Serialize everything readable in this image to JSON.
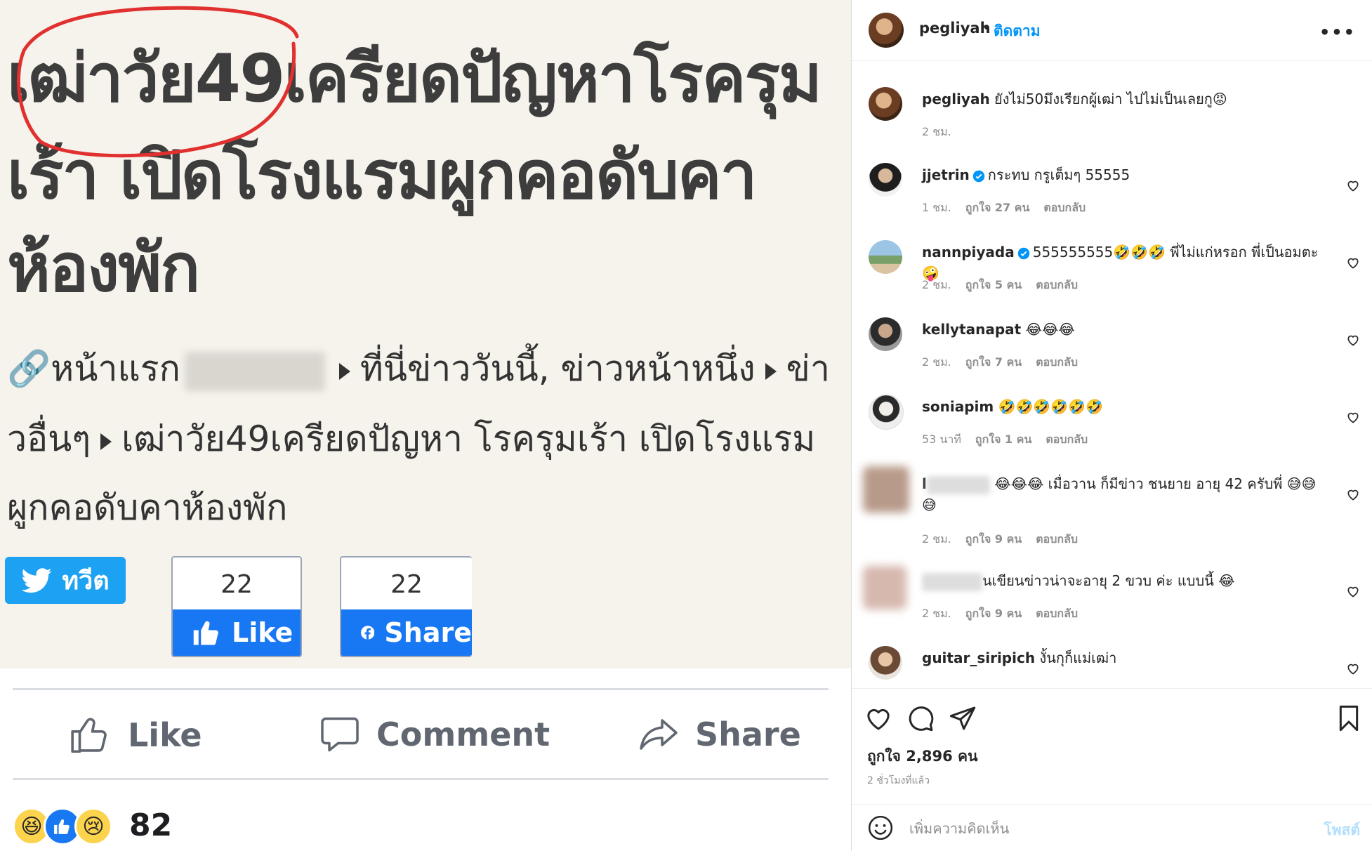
{
  "post_image": {
    "headline_lines": [
      "เฒ่าวัย49เครียดปัญหาโรครุม",
      "เร้า เปิดโรงแรมผูกคอดับคา",
      "ห้องพัก"
    ],
    "breadcrumb": {
      "line1_start": "หน้าแรก",
      "line1_mid": "ที่นี่ข่าววันนี้, ข่าวหน้าหนึ่ง",
      "line1_end": "ข่า",
      "line2_start": "วอื่นๆ",
      "line2_end": "เฒ่าวัย49เครียดปัญหา โรครุมเร้า เปิดโรงแรม",
      "line3": "ผูกคอดับคาห้องพัก"
    },
    "tweet_label": "ทวีต",
    "like_count": "22",
    "like_label": "Like",
    "share_count": "22",
    "share_label": "Share",
    "fb_actions": {
      "like": "Like",
      "comment": "Comment",
      "share": "Share"
    },
    "reaction_count": "82"
  },
  "instagram": {
    "header": {
      "username": "pegliyah",
      "separator": "•",
      "follow": "ติดตาม"
    },
    "comments": [
      {
        "username": "pegliyah",
        "text": "ยังไม่50มึงเรียกผู้เฒ่า ไปไม่เป็นเลยกู😡",
        "time": "2 ชม.",
        "likes": "",
        "reply": ""
      },
      {
        "username": "jjetrin",
        "text": "กระทบ กรูเต็มๆ 55555",
        "time": "1 ชม.",
        "likes": "ถูกใจ 27 คน",
        "reply": "ตอบกลับ"
      },
      {
        "username": "nannpiyada",
        "text": "555555555🤣🤣🤣 พี่ไม่แก่หรอก พี่เป็นอมตะ🤪",
        "time": "2 ชม.",
        "likes": "ถูกใจ 5 คน",
        "reply": "ตอบกลับ"
      },
      {
        "username": "kellytanapat",
        "text": "😂😂😂",
        "time": "2 ชม.",
        "likes": "ถูกใจ 7 คน",
        "reply": "ตอบกลับ"
      },
      {
        "username": "soniapim",
        "text": "🤣🤣🤣🤣🤣🤣",
        "time": "53 นาที",
        "likes": "ถูกใจ 1 คน",
        "reply": "ตอบกลับ"
      },
      {
        "username": "l",
        "text": "😂😂😂 เมื่อวาน ก็มีข่าว ชนยาย อายุ 42 ครับพี่ 😅😅😅",
        "time": "2 ชม.",
        "likes": "ถูกใจ 9 คน",
        "reply": "ตอบกลับ"
      },
      {
        "username": "",
        "text": "นเขียนข่าวน่าจะอายุ 2 ขวบ ค่ะ แบบนี้ 😂",
        "time": "2 ชม.",
        "likes": "ถูกใจ 9 คน",
        "reply": "ตอบกลับ"
      },
      {
        "username": "guitar_siripich",
        "text": "งั้นกุก็แม่เฒ่า",
        "time": "",
        "likes": "",
        "reply": ""
      }
    ],
    "likes_total": "ถูกใจ 2,896 คน",
    "post_time": "2 ชั่วโมงที่แล้ว",
    "add_comment_placeholder": "เพิ่มความคิดเห็น",
    "post_button": "โพสต์"
  },
  "colors": {
    "ig_link": "#0095f6",
    "fb_blue": "#1877f2",
    "twitter_blue": "#1da1f2",
    "circle_red": "#e0302f",
    "news_bg": "#f6f3ec"
  }
}
